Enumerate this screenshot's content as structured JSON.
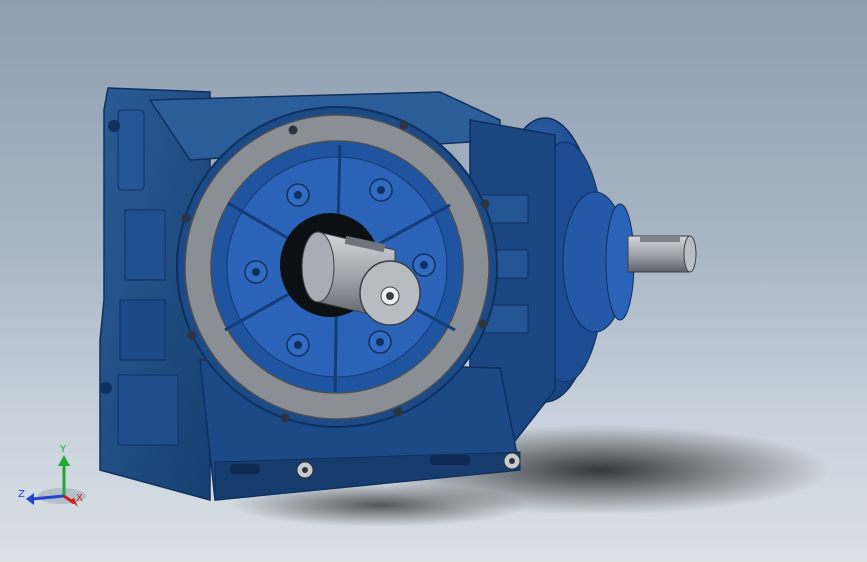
{
  "viewport": {
    "background_top": "#8e9db0",
    "background_bottom": "#d9e0e6"
  },
  "model": {
    "body_color": "#1f4f8a",
    "body_dark": "#143a6b",
    "flange_color": "#8a8f96",
    "shaft_color": "#9aa0a7",
    "accent_blue": "#2a5fb0"
  },
  "triad": {
    "x_label": "X",
    "y_label": "Y",
    "z_label": "Z",
    "x_color": "#cc2222",
    "y_color": "#22aa33",
    "z_color": "#2244cc"
  }
}
